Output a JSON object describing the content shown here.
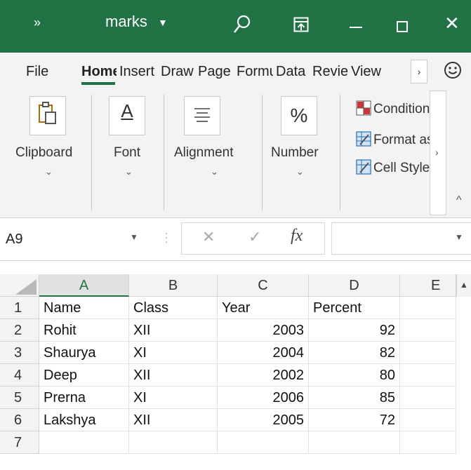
{
  "titlebar": {
    "more_chevron": "»",
    "file_title": "marks",
    "title_caret": "▼",
    "close_glyph": "✕",
    "background_color": "#217346"
  },
  "tabs": {
    "file": "File",
    "home": "Home",
    "insert": "Insert",
    "draw": "Draw",
    "page_layout": "Page Layout",
    "formulas": "Formulas",
    "data": "Data",
    "review": "Review",
    "view": "View",
    "more_glyph": "›",
    "active_tab": "Home"
  },
  "ribbon": {
    "clipboard": "Clipboard",
    "font": "Font",
    "alignment": "Alignment",
    "number": "Number",
    "percent_symbol": "%",
    "font_symbol": "A",
    "caret": "⌄",
    "conditional_formatting": "Conditional Formatting",
    "format_as_table": "Format as Table",
    "cell_styles": "Cell Styles",
    "styles_more": "›",
    "collapse": "^"
  },
  "formula_bar": {
    "name_box": "A9",
    "caret": "▼",
    "dots": "⋮",
    "cancel": "✕",
    "enter": "✓",
    "fx": "fx",
    "formula": ""
  },
  "grid": {
    "columns": [
      "A",
      "B",
      "C",
      "D",
      "E"
    ],
    "rows": [
      "1",
      "2",
      "3",
      "4",
      "5",
      "6",
      "7"
    ],
    "selected_column": "A",
    "scroll_up": "▲",
    "header": {
      "name": "Name",
      "class": "Class",
      "year": "Year",
      "percent": "Percent"
    },
    "data": [
      {
        "name": "Rohit",
        "class": "XII",
        "year": "2003",
        "percent": "92"
      },
      {
        "name": "Shaurya",
        "class": "XI",
        "year": "2004",
        "percent": "82"
      },
      {
        "name": "Deep",
        "class": "XII",
        "year": "2002",
        "percent": "80"
      },
      {
        "name": "Prerna",
        "class": "XI",
        "year": "2006",
        "percent": "85"
      },
      {
        "name": "Lakshya",
        "class": "XII",
        "year": "2005",
        "percent": "72"
      }
    ]
  }
}
